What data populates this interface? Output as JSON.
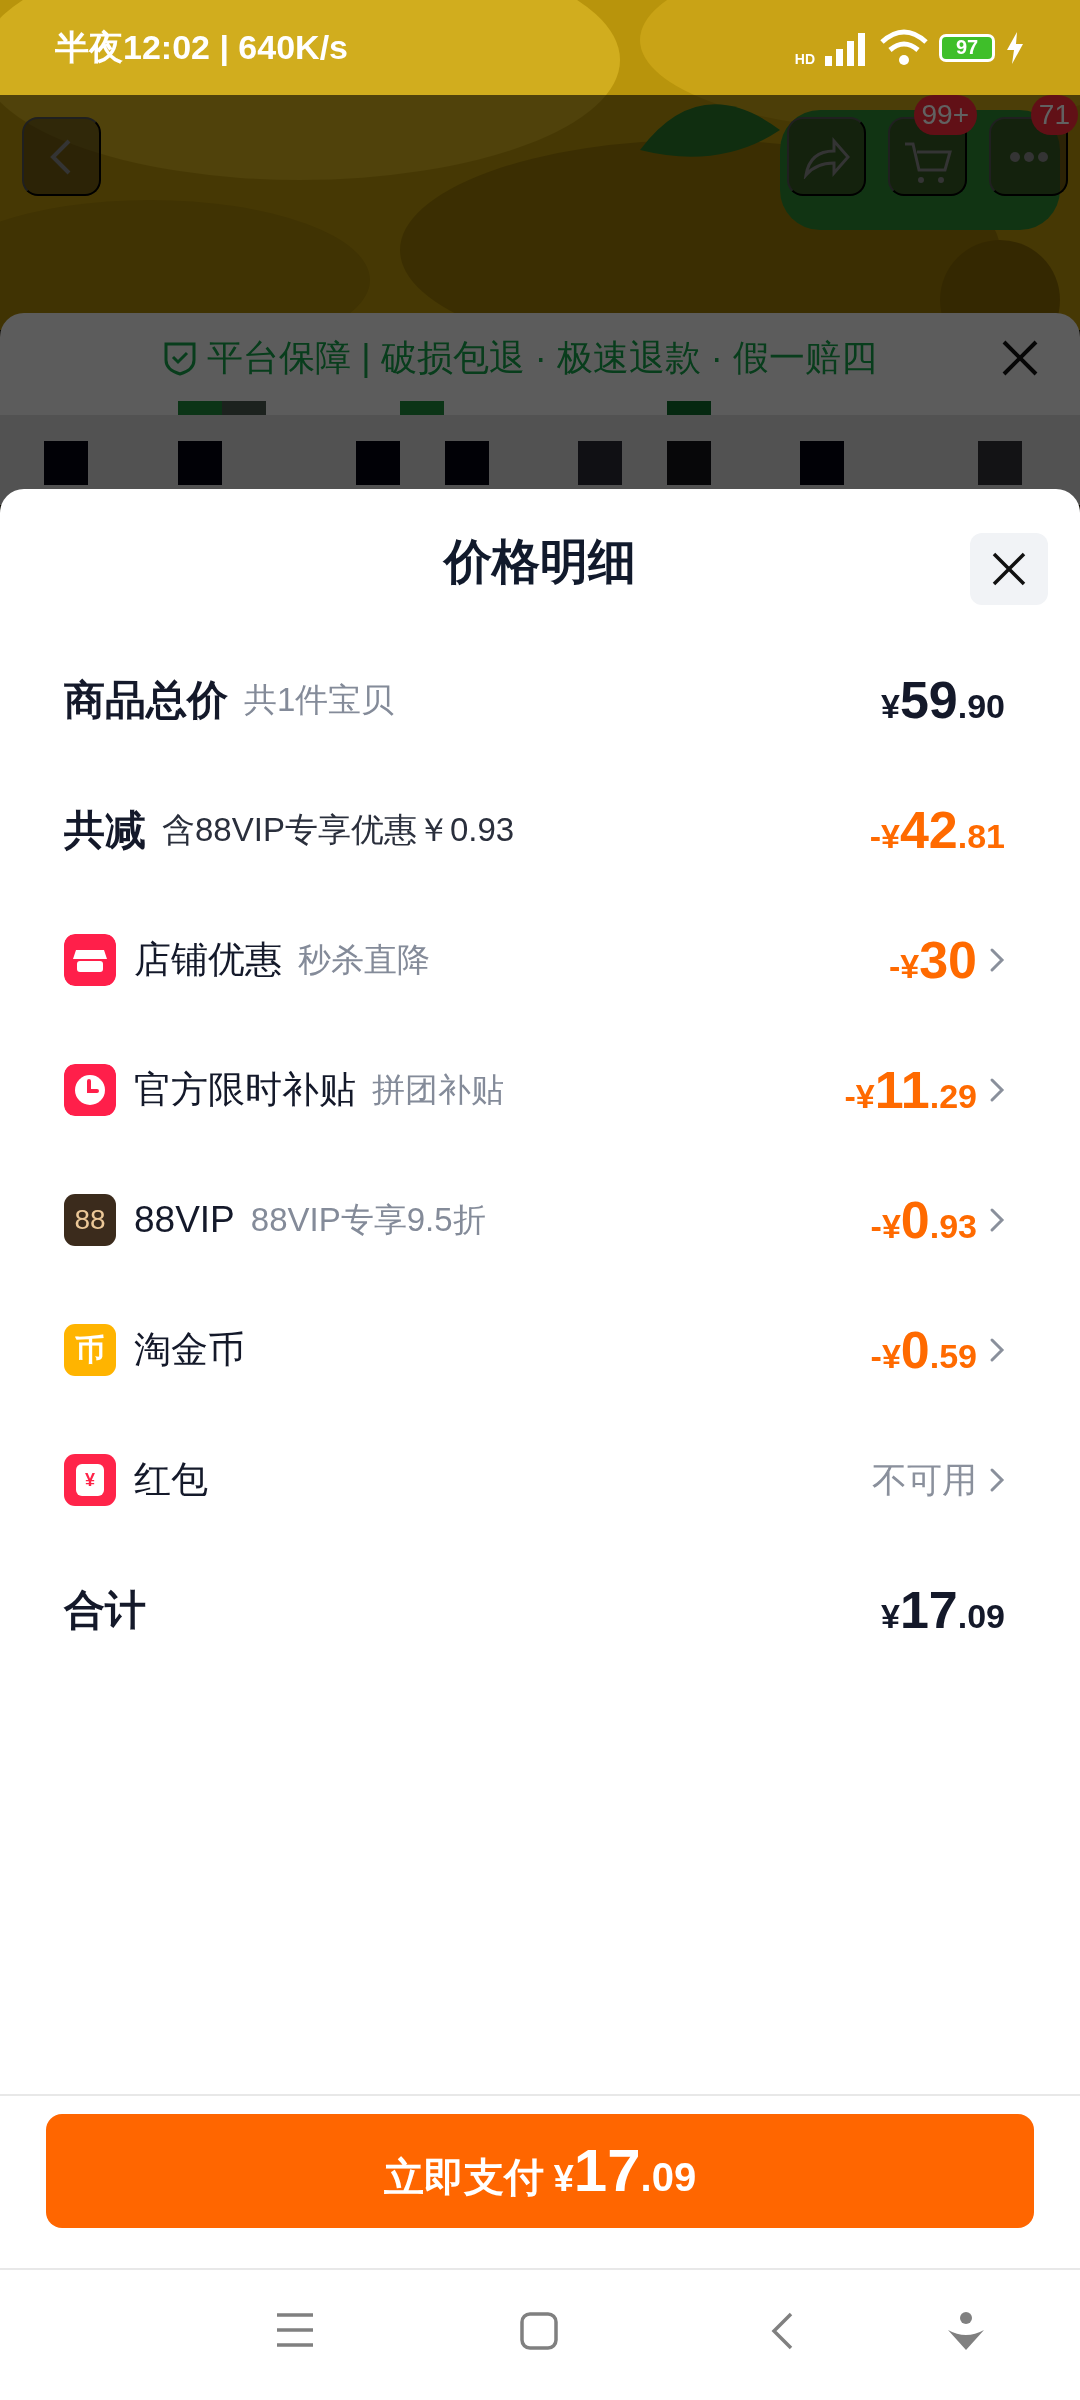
{
  "status_bar": {
    "time": "半夜12:02 | 640K/s",
    "network": "HD",
    "battery": "97"
  },
  "header": {
    "cart_badge": "99+",
    "message_badge": "71"
  },
  "guarantee_sheet": {
    "text": "平台保障 | 破损包退 · 极速退款 · 假一赔四"
  },
  "price_sheet": {
    "title": "价格明细",
    "rows": [
      {
        "kind": "summary",
        "label": "商品总价",
        "note": "共1件宝贝",
        "amount": {
          "prefix": "¥",
          "integer": "59",
          "decimal": ".90"
        }
      },
      {
        "kind": "reduction",
        "label": "共减",
        "note": "含88VIP专享优惠￥0.93",
        "amount": {
          "prefix": "-¥",
          "integer": "42",
          "decimal": ".81"
        }
      },
      {
        "kind": "shop",
        "label": "店铺优惠",
        "note": "秒杀直降",
        "amount": {
          "prefix": "-¥",
          "integer": "30"
        }
      },
      {
        "kind": "clock",
        "label": "官方限时补贴",
        "note": "拼团补贴",
        "amount": {
          "prefix": "-¥",
          "integer": "11",
          "decimal": ".29"
        }
      },
      {
        "kind": "vip",
        "icon_text": "88",
        "label": "88VIP",
        "note": "88VIP专享9.5折",
        "amount": {
          "prefix": "-¥",
          "integer": "0",
          "decimal": ".93"
        }
      },
      {
        "kind": "coin",
        "icon_text": "币",
        "label": "淘金币",
        "amount": {
          "prefix": "-¥",
          "integer": "0",
          "decimal": ".59"
        }
      },
      {
        "kind": "packet",
        "icon_text": "¥",
        "label": "红包",
        "status": "不可用"
      },
      {
        "kind": "summary",
        "label": "合计",
        "amount": {
          "prefix": "¥",
          "integer": "17",
          "decimal": ".09"
        }
      }
    ],
    "pay_button": {
      "label": "立即支付",
      "prefix": "¥",
      "integer": "17",
      "decimal": ".09"
    }
  }
}
